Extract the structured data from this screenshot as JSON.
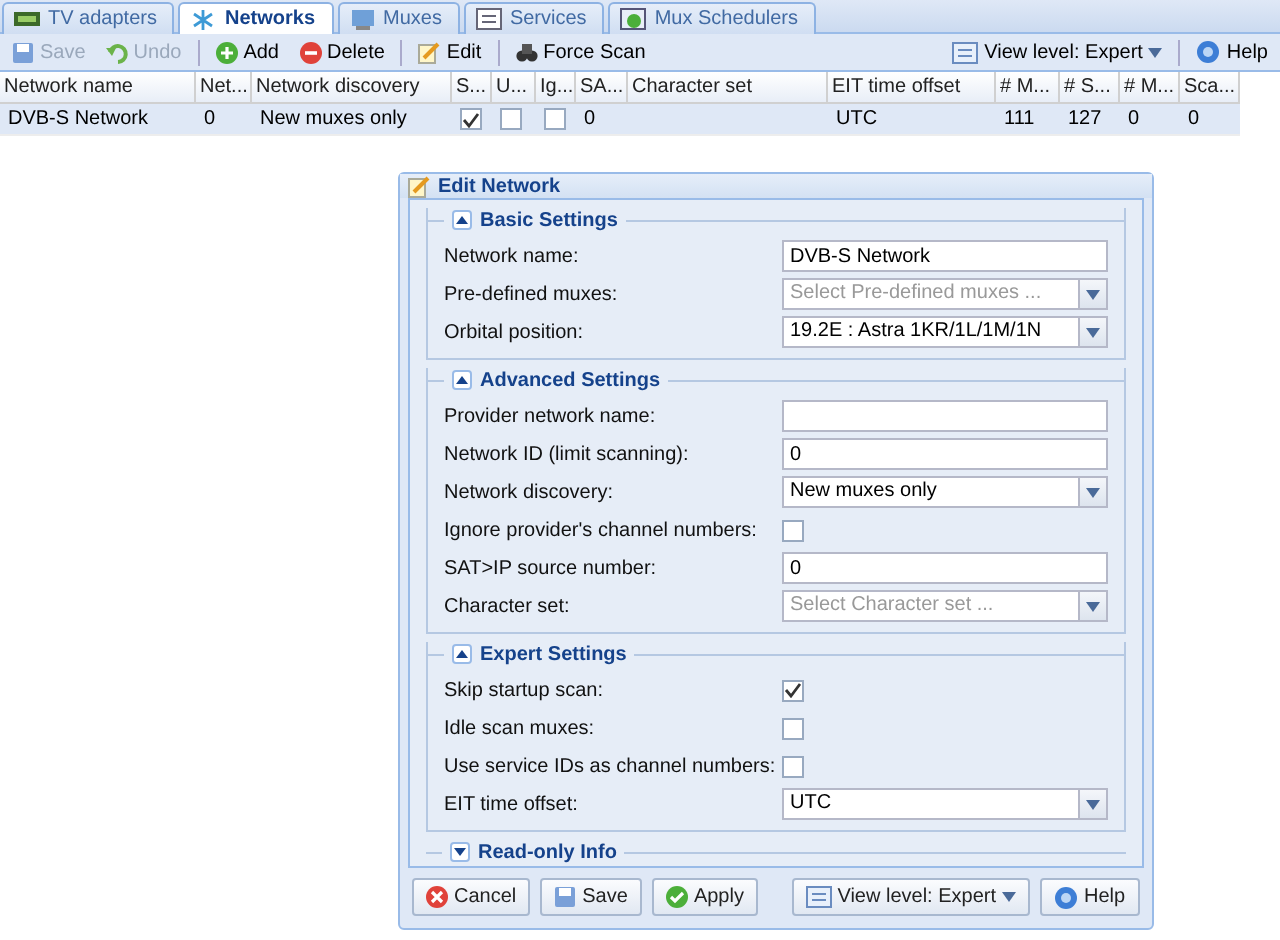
{
  "tabs": [
    {
      "label": "TV adapters",
      "selected": false
    },
    {
      "label": "Networks",
      "selected": true
    },
    {
      "label": "Muxes",
      "selected": false
    },
    {
      "label": "Services",
      "selected": false
    },
    {
      "label": "Mux Schedulers",
      "selected": false
    }
  ],
  "toolbar": {
    "buttons": [
      {
        "label": "Save",
        "disabled": true
      },
      {
        "label": "Undo",
        "disabled": true
      },
      {
        "label": "Add",
        "disabled": false
      },
      {
        "label": "Delete",
        "disabled": false
      },
      {
        "label": "Edit",
        "disabled": false
      },
      {
        "label": "Force Scan",
        "disabled": false
      }
    ],
    "view_level": "View level: Expert",
    "help": "Help"
  },
  "table": {
    "columns": [
      "Network name",
      "Net...",
      "Network discovery",
      "S...",
      "U...",
      "Ig...",
      "SA...",
      "Character set",
      "EIT time offset",
      "# M...",
      "# S...",
      "# M...",
      "Sca..."
    ],
    "rows": [
      {
        "selected": true,
        "cells": [
          {
            "kind": "text",
            "text": "DVB-S Network"
          },
          {
            "kind": "text",
            "text": "0"
          },
          {
            "kind": "text",
            "text": "New muxes only"
          },
          {
            "kind": "check",
            "checked": true
          },
          {
            "kind": "check",
            "checked": false
          },
          {
            "kind": "check",
            "checked": false
          },
          {
            "kind": "text",
            "text": "0"
          },
          {
            "kind": "text",
            "text": ""
          },
          {
            "kind": "text",
            "text": "UTC"
          },
          {
            "kind": "text",
            "text": "111"
          },
          {
            "kind": "text",
            "text": "127"
          },
          {
            "kind": "text",
            "text": "0"
          },
          {
            "kind": "text",
            "text": "0"
          }
        ]
      }
    ]
  },
  "dialog": {
    "title": "Edit Network",
    "sections": [
      {
        "title": "Basic Settings",
        "expanded": true,
        "fields": [
          {
            "kind": "text",
            "label": "Network name:",
            "value": "DVB-S Network"
          },
          {
            "kind": "combo",
            "label": "Pre-defined muxes:",
            "placeholder": "Select Pre-defined muxes ..."
          },
          {
            "kind": "combo",
            "label": "Orbital position:",
            "value": "19.2E : Astra 1KR/1L/1M/1N"
          }
        ]
      },
      {
        "title": "Advanced Settings",
        "expanded": true,
        "fields": [
          {
            "kind": "text",
            "label": "Provider network name:"
          },
          {
            "kind": "text",
            "label": "Network ID (limit scanning):",
            "value": "0"
          },
          {
            "kind": "combo",
            "label": "Network discovery:",
            "value": "New muxes only"
          },
          {
            "kind": "checkbox",
            "label": "Ignore provider's channel numbers:",
            "checked": false
          },
          {
            "kind": "text",
            "label": "SAT>IP source number:",
            "value": "0"
          },
          {
            "kind": "combo",
            "label": "Character set:",
            "placeholder": "Select Character set ..."
          }
        ]
      },
      {
        "title": "Expert Settings",
        "expanded": true,
        "fields": [
          {
            "kind": "checkbox",
            "label": "Skip startup scan:",
            "checked": true
          },
          {
            "kind": "checkbox",
            "label": "Idle scan muxes:",
            "checked": false
          },
          {
            "kind": "checkbox",
            "label": "Use service IDs as channel numbers:",
            "checked": false
          },
          {
            "kind": "combo",
            "label": "EIT time offset:",
            "value": "UTC"
          }
        ]
      },
      {
        "title": "Read-only Info",
        "expanded": false
      }
    ],
    "buttons": [
      "Cancel",
      "Save",
      "Apply"
    ],
    "view_level": "View level: Expert",
    "help": "Help"
  }
}
